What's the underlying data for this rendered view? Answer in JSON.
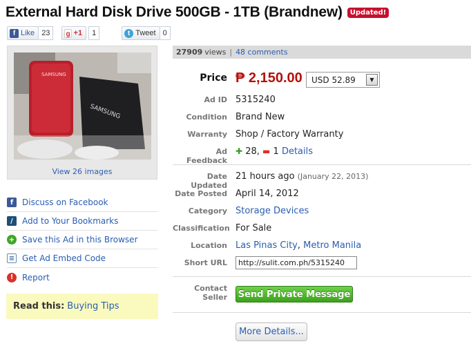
{
  "listing": {
    "title": "External Hard Disk Drive 500GB - 1TB (Brandnew)",
    "badge": "Updated!"
  },
  "social": {
    "like_label": "Like",
    "like_count": "23",
    "gplus_label": "+1",
    "gplus_count": "1",
    "tweet_label": "Tweet",
    "tweet_count": "0"
  },
  "gallery": {
    "view_label": "View 26 images",
    "photo_text_1": "SAMSUNG",
    "photo_text_2": "SAMSUNG"
  },
  "actions": [
    {
      "label": "Discuss on Facebook",
      "icon": "facebook-icon"
    },
    {
      "label": "Add to Your Bookmarks",
      "icon": "bookmark-icon"
    },
    {
      "label": "Save this Ad in this Browser",
      "icon": "plus-circle-icon"
    },
    {
      "label": "Get Ad Embed Code",
      "icon": "embed-icon"
    },
    {
      "label": "Report",
      "icon": "alert-icon"
    }
  ],
  "tips": {
    "label": "Read this:",
    "link": "Buying Tips"
  },
  "stats": {
    "views_count": "27909",
    "views_label": "views",
    "separator": "|",
    "comments": "48 comments"
  },
  "details": {
    "price_label": "Price",
    "price": "₱ 2,150.00",
    "currency_select": "USD 52.89",
    "ad_id_label": "Ad ID",
    "ad_id": "5315240",
    "condition_label": "Condition",
    "condition": "Brand New",
    "warranty_label": "Warranty",
    "warranty": "Shop / Factory Warranty",
    "feedback_label": "Ad Feedback",
    "feedback_positive": "28,",
    "feedback_negative": "1",
    "feedback_details": "Details",
    "date_updated_label": "Date Updated",
    "date_updated": "21 hours ago",
    "date_updated_exact": "(January 22, 2013)",
    "date_posted_label": "Date Posted",
    "date_posted": "April 14, 2012",
    "category_label": "Category",
    "category": "Storage Devices",
    "classification_label": "Classification",
    "classification": "For Sale",
    "location_label": "Location",
    "location_city": "Las Pinas City",
    "location_sep": ",",
    "location_region": "Metro Manila",
    "short_url_label": "Short URL",
    "short_url": "http://sulit.com.ph/5315240",
    "contact_label": "Contact Seller",
    "send_button": "Send Private Message",
    "more_button": "More Details..."
  },
  "colors": {
    "price": "#b3120b",
    "link": "#2a5db0",
    "badge": "#c8102e",
    "send_button": "#3da11d",
    "tips_bg": "#fafabf"
  }
}
